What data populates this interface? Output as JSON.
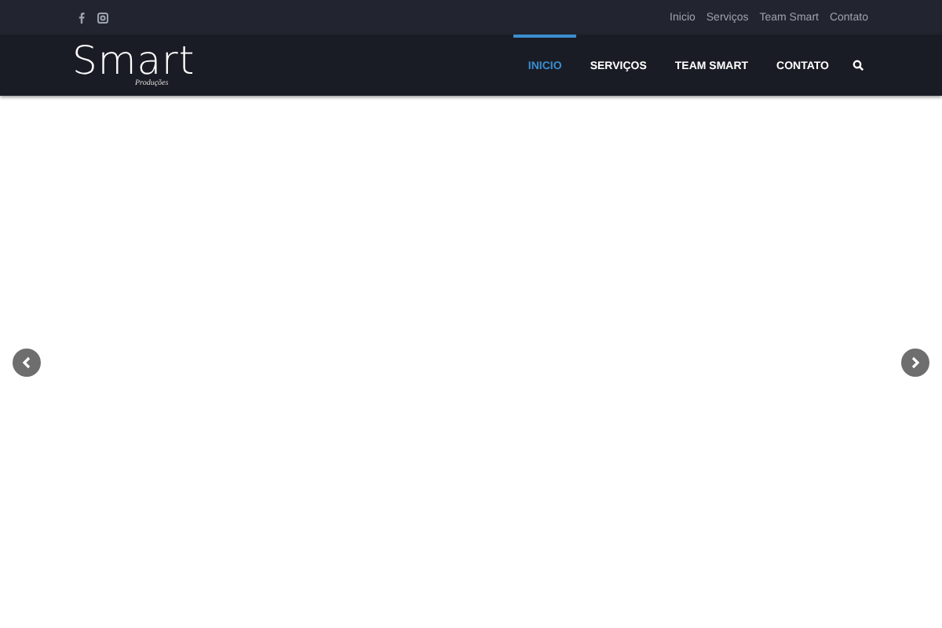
{
  "top_bar": {
    "links": [
      "Inicio",
      "Serviços",
      "Team Smart",
      "Contato"
    ]
  },
  "logo": {
    "name": "Smart",
    "tagline": "Produções"
  },
  "nav": {
    "items": [
      {
        "label": "INICIO",
        "selected": true
      },
      {
        "label": "SERVIÇOS",
        "selected": false
      },
      {
        "label": "TEAM SMART",
        "selected": false
      },
      {
        "label": "CONTATO",
        "selected": false
      }
    ]
  }
}
